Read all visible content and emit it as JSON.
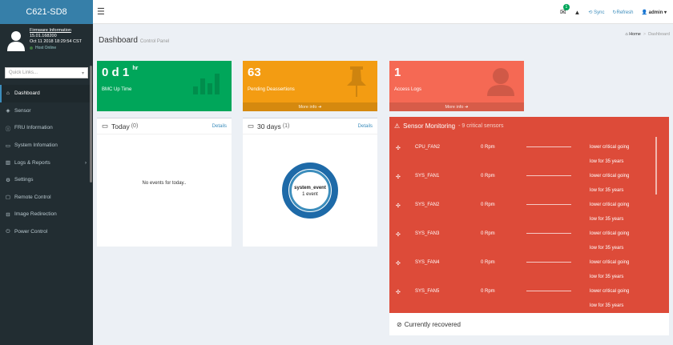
{
  "app": {
    "brand": "C621-SD8"
  },
  "user_panel": {
    "firmware_label": "Firmware Information",
    "firmware_version": "15.01.168200",
    "datetime": "Oct 11 2018 18:29:54 CST",
    "host_status": "Host Online"
  },
  "quicklinks": {
    "placeholder": "Quick Links..."
  },
  "nav": [
    {
      "icon": "tachometer-icon",
      "label": "Dashboard",
      "active": true
    },
    {
      "icon": "sensor-icon",
      "label": "Sensor"
    },
    {
      "icon": "info-icon",
      "label": "FRU Information"
    },
    {
      "icon": "monitor-icon",
      "label": "System Infomation"
    },
    {
      "icon": "chart-icon",
      "label": "Logs & Reports",
      "has_submenu": true
    },
    {
      "icon": "gear-icon",
      "label": "Settings"
    },
    {
      "icon": "desktop-icon",
      "label": "Remote Control"
    },
    {
      "icon": "hdd-icon",
      "label": "Image Redirection"
    },
    {
      "icon": "power-icon",
      "label": "Power Control"
    }
  ],
  "topbar": {
    "notifications_badge": "1",
    "sync_label": "Sync",
    "refresh_label": "Refresh",
    "user_label": "admin"
  },
  "header": {
    "title": "Dashboard",
    "subtitle": "Control Panel"
  },
  "breadcrumb": {
    "home": "Home",
    "current": "Dashboard"
  },
  "boxes": {
    "uptime": {
      "days": "0",
      "d": "d",
      "hours": "1",
      "hr": "hr",
      "label": "BMC Up Time",
      "color": "#00a65a"
    },
    "deassertions": {
      "value": "63",
      "label": "Pending Deassertions",
      "more": "More info",
      "color": "#f39c12"
    },
    "access_logs": {
      "value": "1",
      "label": "Access Logs",
      "more": "More info",
      "color": "#f56954"
    }
  },
  "today_card": {
    "title": "Today",
    "count": "(0)",
    "details": "Details",
    "empty": "No events for today.."
  },
  "thirty_card": {
    "title": "30 days",
    "count": "(1)",
    "details": "Details"
  },
  "donut": {
    "label": "system_event",
    "count": "1 event",
    "outer_color": "#1e6aa8",
    "inner_color": "#3c8dbc"
  },
  "sensor_monitoring": {
    "title": "Sensor Monitoring",
    "critical": "- 9 critical sensors",
    "rows": [
      {
        "name": "CPU_FAN2",
        "value": "0 Rpm",
        "status_1": "lower critical going",
        "status_2": "low for 35 years"
      },
      {
        "name": "SYS_FAN1",
        "value": "0 Rpm",
        "status_1": "lower critical going",
        "status_2": "low for 35 years"
      },
      {
        "name": "SYS_FAN2",
        "value": "0 Rpm",
        "status_1": "lower critical going",
        "status_2": "low for 35 years"
      },
      {
        "name": "SYS_FAN3",
        "value": "0 Rpm",
        "status_1": "lower critical going",
        "status_2": "low for 35 years"
      },
      {
        "name": "SYS_FAN4",
        "value": "0 Rpm",
        "status_1": "lower critical going",
        "status_2": "low for 35 years"
      },
      {
        "name": "SYS_FAN5",
        "value": "0 Rpm",
        "status_1": "lower critical going",
        "status_2": "low for 35 years"
      }
    ],
    "recovered_label": "Currently recovered"
  }
}
